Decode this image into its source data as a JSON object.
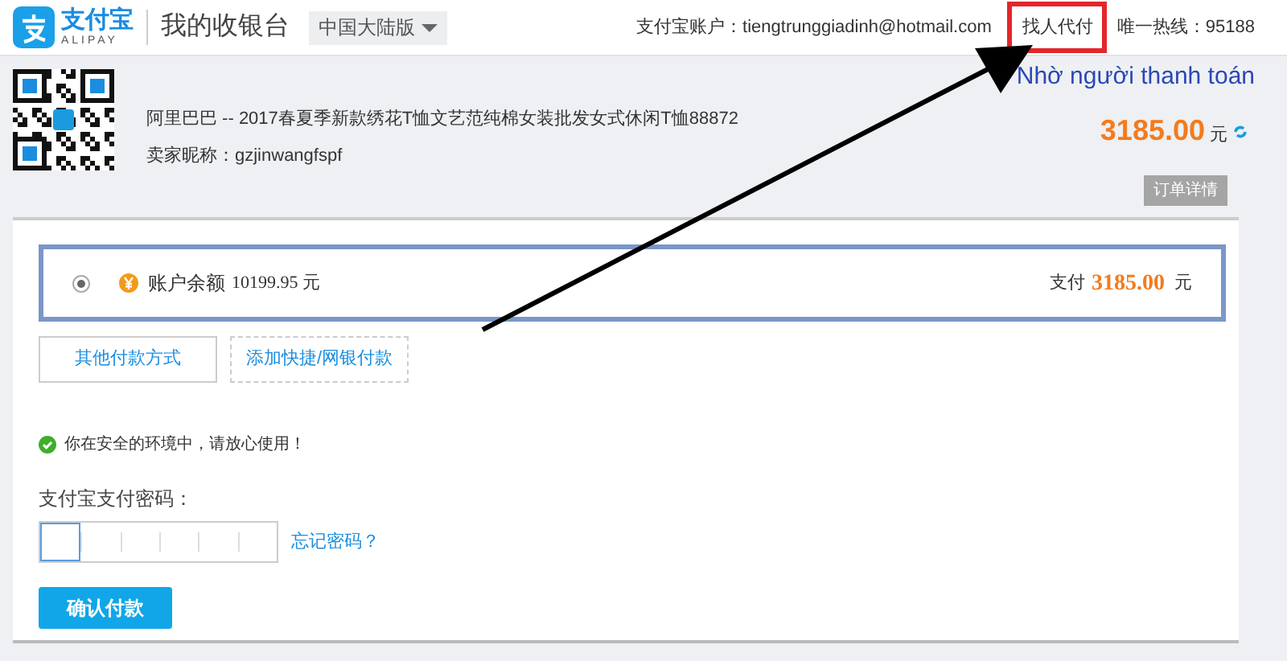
{
  "header": {
    "logo": {
      "name": "支付宝",
      "sub": "ALIPAY"
    },
    "title": "我的收银台",
    "region": "中国大陆版",
    "account": "支付宝账户：tiengtrunggiadinh@hotmail.com",
    "find_payer": {
      "label": "找人代付",
      "highlighted": true
    },
    "hotline": "唯一热线：95188"
  },
  "annotation": {
    "text": "Nhờ người thanh toán"
  },
  "order": {
    "title": "阿里巴巴 -- 2017春夏季新款绣花T恤文艺范纯棉女装批发女式休闲T恤88872",
    "seller": "卖家昵称：gzjinwangfspf",
    "amount": "3185.00",
    "currency": "元",
    "details_tab": "订单详情"
  },
  "payment_method": {
    "selected": true,
    "label": "账户余额",
    "balance": "10199.95 元",
    "pay_label": "支付",
    "pay_amount": "3185.00",
    "currency": "元"
  },
  "buttons": [
    {
      "label": "其他付款方式",
      "kind": "solid"
    },
    {
      "label": "添加快捷/网银付款",
      "kind": "dashed"
    }
  ],
  "security": "你在安全的环境中，请放心使用！",
  "password": {
    "label": "支付宝支付密码：",
    "forgot": "忘记密码？"
  },
  "confirm": "确认付款"
}
